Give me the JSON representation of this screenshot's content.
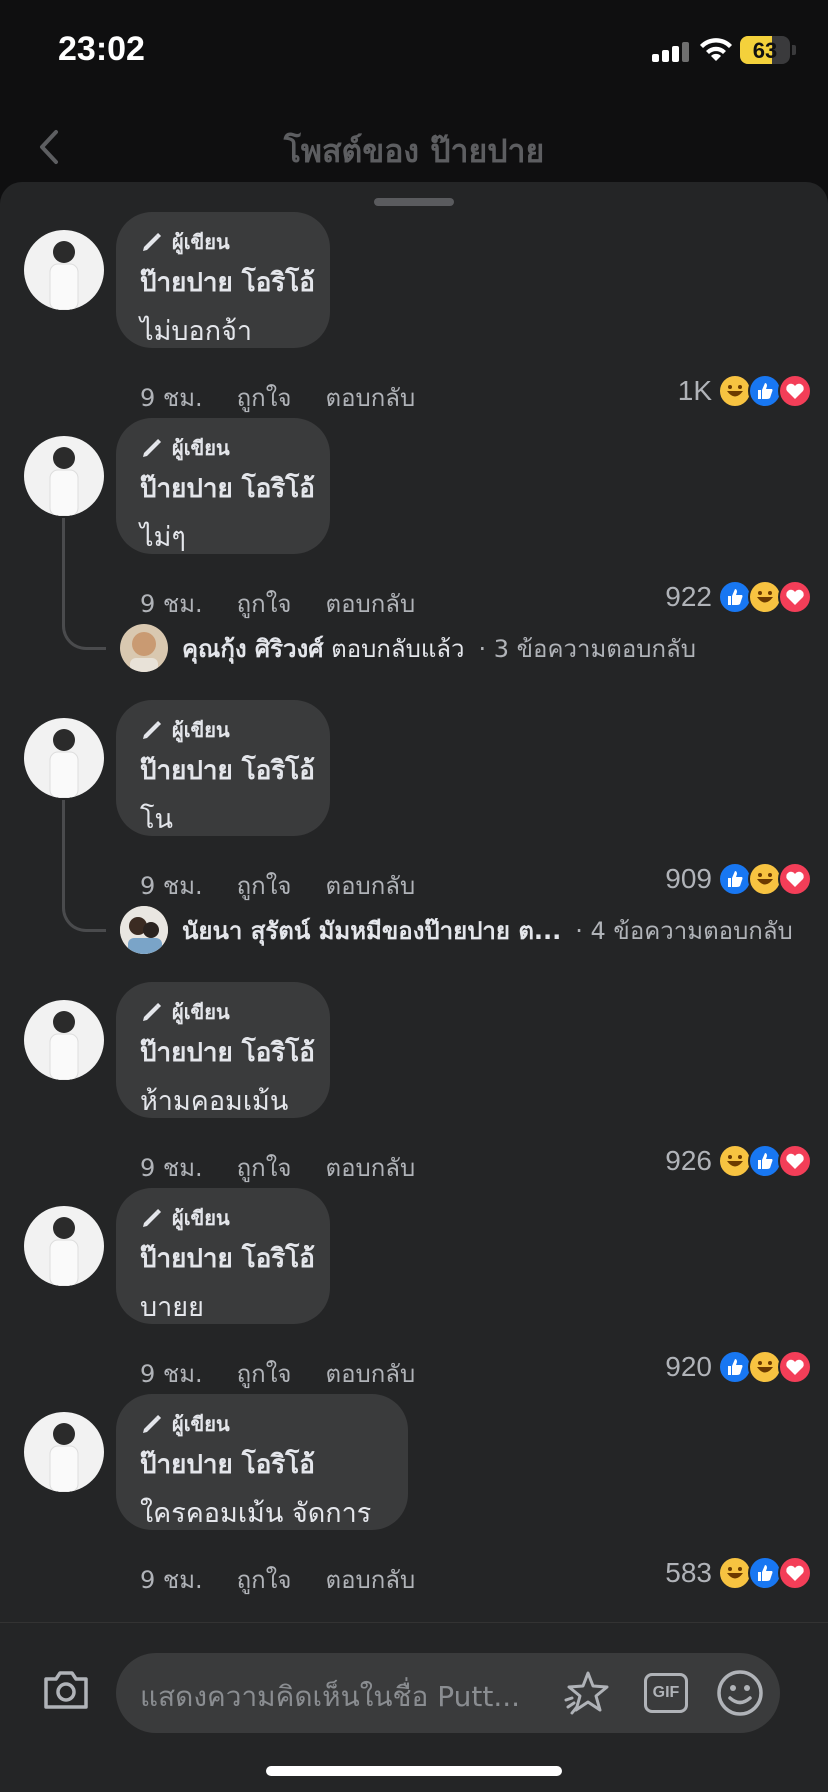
{
  "status": {
    "time": "23:02",
    "battery": "63"
  },
  "header": {
    "title": "โพสต์ของ ป๊ายปาย"
  },
  "author_tag": "ผู้เขียน",
  "actions": {
    "like": "ถูกใจ",
    "reply": "ตอบกลับ"
  },
  "comments": [
    {
      "name": "ป๊ายปาย โอริโอ้",
      "text": "ไม่บอกจ้า",
      "time": "9 ชม.",
      "reactions": "1K",
      "emojis": [
        "haha",
        "like",
        "love"
      ]
    },
    {
      "name": "ป๊ายปาย โอริโอ้",
      "text": "ไม่ๆ",
      "time": "9 ชม.",
      "reactions": "922",
      "emojis": [
        "like",
        "haha",
        "love"
      ],
      "reply": {
        "who": "คุณกุ้ง ศิริวงศ์",
        "suffix": " ตอบกลับแล้ว",
        "count": "· 3 ข้อความตอบกลับ"
      }
    },
    {
      "name": "ป๊ายปาย โอริโอ้",
      "text": "โน",
      "time": "9 ชม.",
      "reactions": "909",
      "emojis": [
        "like",
        "haha",
        "love"
      ],
      "reply": {
        "who": "นัยนา สุรัตน์ มัมหมีของป๊ายปาย ต...",
        "suffix": "",
        "count": "· 4 ข้อความตอบกลับ"
      }
    },
    {
      "name": "ป๊ายปาย โอริโอ้",
      "text": "ห้ามคอมเม้น",
      "time": "9 ชม.",
      "reactions": "926",
      "emojis": [
        "haha",
        "like",
        "love"
      ]
    },
    {
      "name": "ป๊ายปาย โอริโอ้",
      "text": "บายย",
      "time": "9 ชม.",
      "reactions": "920",
      "emojis": [
        "like",
        "haha",
        "love"
      ]
    },
    {
      "name": "ป๊ายปาย โอริโอ้",
      "text": "ใครคอมเม้น จัดการ",
      "time": "9 ชม.",
      "reactions": "583",
      "emojis": [
        "haha",
        "like",
        "love"
      ]
    }
  ],
  "composer": {
    "placeholder": "แสดงความคิดเห็นในชื่อ Putt...",
    "gif": "GIF"
  },
  "colors": {
    "like": "#1877f2",
    "haha": "#f7c341",
    "love": "#f33e58",
    "bubble": "#3a3b3c"
  }
}
